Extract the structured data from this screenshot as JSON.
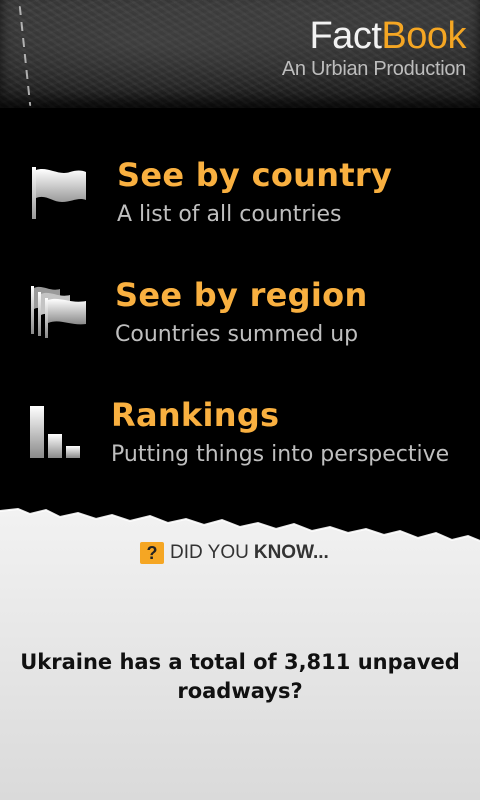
{
  "header": {
    "brand_first": "Fact",
    "brand_second": "Book",
    "subtitle": "An Urbian Production"
  },
  "menu": [
    {
      "title": "See by country",
      "subtitle": "A list of all countries",
      "icon": "flag-icon"
    },
    {
      "title": "See by region",
      "subtitle": "Countries summed up",
      "icon": "flags-icon"
    },
    {
      "title": "Rankings",
      "subtitle": "Putting things into perspective",
      "icon": "bar-chart-icon"
    }
  ],
  "did_you_know": {
    "badge": "?",
    "lead": "DID YOU",
    "bold": "KNOW..."
  },
  "fact_text": "Ukraine has a total of 3,811 unpaved roadways?",
  "colors": {
    "accent": "#f9b040",
    "brand_orange": "#f5a623",
    "subtitle_gray": "#bfbfbf",
    "background": "#000000",
    "paper": "#ececec"
  }
}
